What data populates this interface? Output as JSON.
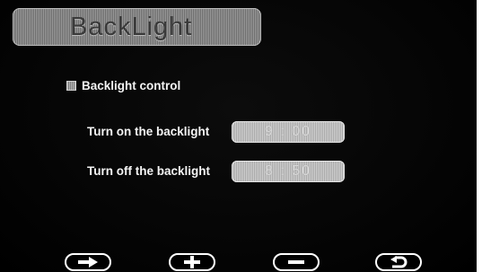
{
  "title": "BackLight",
  "backlight_control": {
    "label": "Backlight control",
    "checked": true
  },
  "turn_on": {
    "label": "Turn on the backlight",
    "value": "9 : 00"
  },
  "turn_off": {
    "label": "Turn off the backlight",
    "value": "8 : 50"
  },
  "buttons": [
    {
      "icon": "arrow-right-icon"
    },
    {
      "icon": "plus-icon"
    },
    {
      "icon": "minus-icon"
    },
    {
      "icon": "return-icon"
    }
  ]
}
